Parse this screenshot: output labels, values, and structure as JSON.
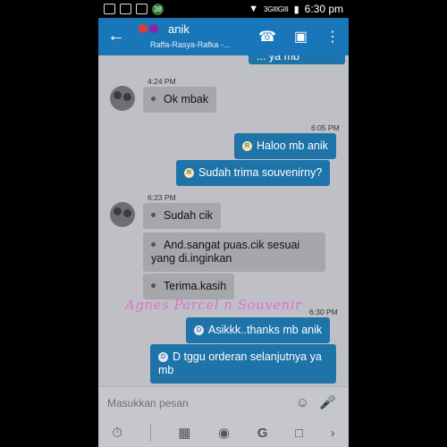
{
  "status_bar": {
    "notification_count": "38",
    "network": "3GIIIGIII",
    "time": "6:30 pm"
  },
  "header": {
    "back_icon": "arrow-left-icon",
    "title": "anik",
    "subtitle": "Raffa-Rasya-Rafka -...",
    "call_icon": "phone-icon",
    "video_icon": "video-icon",
    "menu_icon": "more-vert-icon"
  },
  "messages": [
    {
      "direction": "out",
      "text": "... ya mb",
      "cut": true
    },
    {
      "direction": "in",
      "time": "4:24 PM",
      "text": "Ok mbak"
    },
    {
      "direction": "out",
      "time": "6:05 PM",
      "marker": "R",
      "text": "Haloo mb anik"
    },
    {
      "direction": "out",
      "marker": "R",
      "text": "Sudah trima souvenirny?"
    },
    {
      "direction": "in",
      "time": "6:23 PM",
      "text": "Sudah cik"
    },
    {
      "direction": "in",
      "text": "And.sangat puas.cik sesuai yang di.inginkan"
    },
    {
      "direction": "in",
      "text": "Terima.kasih"
    },
    {
      "direction": "out",
      "time": "6:30 PM",
      "marker": "D",
      "text": "Asikkk..thanks mb anik"
    },
    {
      "direction": "out",
      "marker": "D",
      "text": "D tggu orderan selanjutnya ya mb"
    }
  ],
  "watermark": "Agnes Parcel n Souvenir",
  "composer": {
    "placeholder": "Masukkan pesan",
    "emoji_icon": "emoji-add-icon",
    "mic_icon": "microphone-icon"
  },
  "toolbar": [
    "timer-icon",
    "image-icon",
    "camera-icon",
    "google-icon",
    "document-icon",
    "chevron-right-icon"
  ]
}
